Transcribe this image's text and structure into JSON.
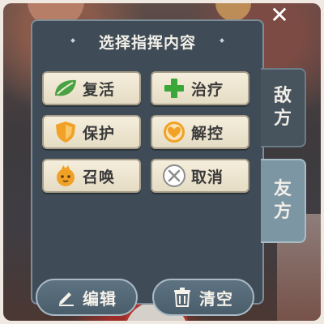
{
  "panel": {
    "title": "选择指挥内容"
  },
  "commands": {
    "revive": {
      "label": "复活",
      "icon": "leaf-icon"
    },
    "heal": {
      "label": "治疗",
      "icon": "plus-icon"
    },
    "protect": {
      "label": "保护",
      "icon": "shield-icon"
    },
    "cleanse": {
      "label": "解控",
      "icon": "heart-shield-icon"
    },
    "summon": {
      "label": "召唤",
      "icon": "summon-creature-icon"
    },
    "cancel": {
      "label": "取消",
      "icon": "cancel-x-icon"
    }
  },
  "tabs": {
    "enemy": {
      "label": "敌\n方",
      "active": false
    },
    "ally": {
      "label": "友\n方",
      "active": true
    }
  },
  "actions": {
    "edit": {
      "label": "编辑",
      "icon": "pencil-icon"
    },
    "clear": {
      "label": "清空",
      "icon": "trash-icon"
    }
  },
  "colors": {
    "panel_bg": "#3f4b56",
    "button_bg": "#f0e8d4",
    "leaf_green": "#4aa142",
    "plus_green": "#39a838",
    "orange": "#f0a126",
    "active_tab": "#7d96a4"
  }
}
